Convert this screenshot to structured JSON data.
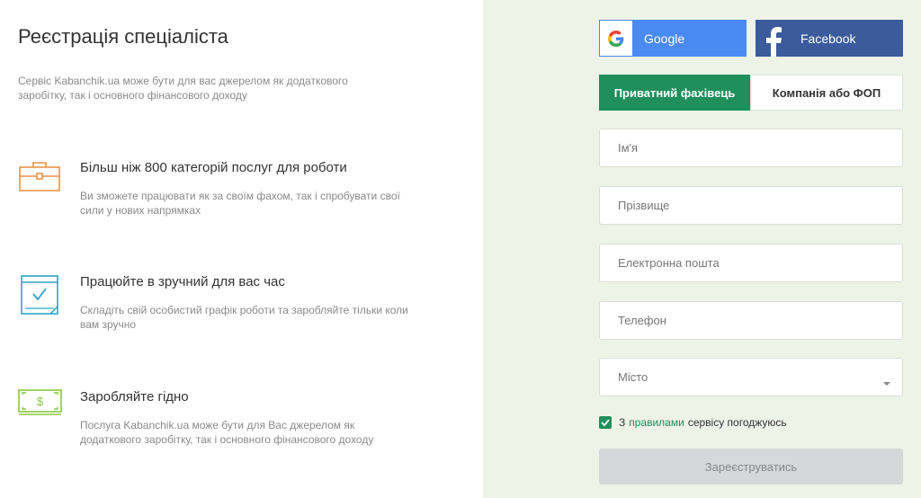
{
  "header": {
    "title": "Реєстрація спеціаліста",
    "subtitle": "Сервіс Kabanchik.ua може бути для вас джерелом як додаткового заробітку, так і основного фінансового доходу"
  },
  "features": [
    {
      "icon": "briefcase-icon",
      "title": "Більш ніж 800 категорій послуг для роботи",
      "description": "Ви зможете працювати як за своїм фахом, так і спробувати свої сили у нових напрямках"
    },
    {
      "icon": "calendar-check-icon",
      "title": "Працюйте в зручний для вас час",
      "description": "Складіть свій особистий графік роботи та заробляйте тільки коли вам зручно"
    },
    {
      "icon": "money-icon",
      "title": "Заробляйте гідно",
      "description": "Послуга Kabanchik.ua може бути для Вас джерелом як додаткового заробітку, так і основного фінансового доходу"
    }
  ],
  "social": {
    "google_label": "Google",
    "facebook_label": "Facebook"
  },
  "tabs": [
    {
      "label": "Приватний фахівець",
      "active": true
    },
    {
      "label": "Компанія або ФОП",
      "active": false
    }
  ],
  "form": {
    "name_placeholder": "Ім'я",
    "surname_placeholder": "Прізвище",
    "email_placeholder": "Електронна пошта",
    "phone_placeholder": "Телефон",
    "city_placeholder": "Місто",
    "agree_prefix": "З",
    "agree_link": "правилами",
    "agree_suffix": "сервісу погоджуюсь",
    "agree_checked": true,
    "submit_label": "Зареєструватись"
  },
  "colors": {
    "accent_green": "#1f8f5b",
    "google_blue": "#4b8af3",
    "facebook_blue": "#3b5b9c",
    "right_panel_bg": "#eef3e8",
    "orange_icon": "#e8944a",
    "teal_icon": "#2aa6c4",
    "green_icon": "#8cc63f"
  }
}
